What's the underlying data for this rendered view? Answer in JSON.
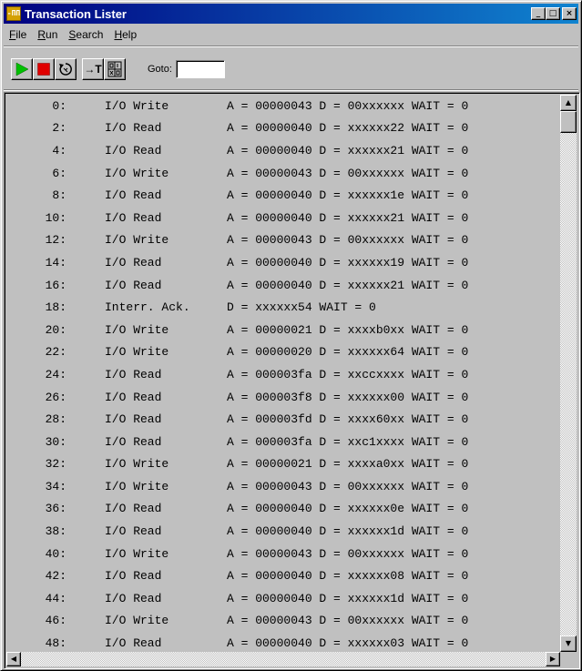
{
  "window": {
    "title": "Transaction Lister",
    "app_icon_text": "-ПП",
    "minimize_glyph": "_",
    "maximize_glyph": "□",
    "close_glyph": "×"
  },
  "menu": {
    "file": "File",
    "run": "Run",
    "search": "Search",
    "help": "Help"
  },
  "toolbar": {
    "buttons": [
      "run-icon",
      "stop-icon",
      "loop-icon",
      "trigger-icon",
      "binary-hex-icon"
    ],
    "trigger_label": "→T",
    "goto_label": "Goto:",
    "goto_value": ""
  },
  "colors": {
    "run": "#00c000",
    "stop": "#e00000",
    "title_start": "#000080",
    "title_end": "#1084d0",
    "face": "#c0c0c0"
  },
  "scrollbar": {
    "up": "▲",
    "down": "▼",
    "left": "◀",
    "right": "▶"
  },
  "rows": [
    {
      "idx": "0:",
      "kind": "I/O Write",
      "detail": "A = 00000043 D = 00xxxxxx WAIT = 0"
    },
    {
      "idx": "2:",
      "kind": "I/O Read",
      "detail": "A = 00000040 D = xxxxxx22 WAIT = 0"
    },
    {
      "idx": "4:",
      "kind": "I/O Read",
      "detail": "A = 00000040 D = xxxxxx21 WAIT = 0"
    },
    {
      "idx": "6:",
      "kind": "I/O Write",
      "detail": "A = 00000043 D = 00xxxxxx WAIT = 0"
    },
    {
      "idx": "8:",
      "kind": "I/O Read",
      "detail": "A = 00000040 D = xxxxxx1e WAIT = 0"
    },
    {
      "idx": "10:",
      "kind": "I/O Read",
      "detail": "A = 00000040 D = xxxxxx21 WAIT = 0"
    },
    {
      "idx": "12:",
      "kind": "I/O Write",
      "detail": "A = 00000043 D = 00xxxxxx WAIT = 0"
    },
    {
      "idx": "14:",
      "kind": "I/O Read",
      "detail": "A = 00000040 D = xxxxxx19 WAIT = 0"
    },
    {
      "idx": "16:",
      "kind": "I/O Read",
      "detail": "A = 00000040 D = xxxxxx21 WAIT = 0"
    },
    {
      "idx": "18:",
      "kind": "Interr. Ack.",
      "detail": "D = xxxxxx54 WAIT = 0"
    },
    {
      "idx": "20:",
      "kind": "I/O Write",
      "detail": "A = 00000021 D = xxxxb0xx WAIT = 0"
    },
    {
      "idx": "22:",
      "kind": "I/O Write",
      "detail": "A = 00000020 D = xxxxxx64 WAIT = 0"
    },
    {
      "idx": "24:",
      "kind": "I/O Read",
      "detail": "A = 000003fa D = xxccxxxx WAIT = 0"
    },
    {
      "idx": "26:",
      "kind": "I/O Read",
      "detail": "A = 000003f8 D = xxxxxx00 WAIT = 0"
    },
    {
      "idx": "28:",
      "kind": "I/O Read",
      "detail": "A = 000003fd D = xxxx60xx WAIT = 0"
    },
    {
      "idx": "30:",
      "kind": "I/O Read",
      "detail": "A = 000003fa D = xxc1xxxx WAIT = 0"
    },
    {
      "idx": "32:",
      "kind": "I/O Write",
      "detail": "A = 00000021 D = xxxxa0xx WAIT = 0"
    },
    {
      "idx": "34:",
      "kind": "I/O Write",
      "detail": "A = 00000043 D = 00xxxxxx WAIT = 0"
    },
    {
      "idx": "36:",
      "kind": "I/O Read",
      "detail": "A = 00000040 D = xxxxxx0e WAIT = 0"
    },
    {
      "idx": "38:",
      "kind": "I/O Read",
      "detail": "A = 00000040 D = xxxxxx1d WAIT = 0"
    },
    {
      "idx": "40:",
      "kind": "I/O Write",
      "detail": "A = 00000043 D = 00xxxxxx WAIT = 0"
    },
    {
      "idx": "42:",
      "kind": "I/O Read",
      "detail": "A = 00000040 D = xxxxxx08 WAIT = 0"
    },
    {
      "idx": "44:",
      "kind": "I/O Read",
      "detail": "A = 00000040 D = xxxxxx1d WAIT = 0"
    },
    {
      "idx": "46:",
      "kind": "I/O Write",
      "detail": "A = 00000043 D = 00xxxxxx WAIT = 0"
    },
    {
      "idx": "48:",
      "kind": "I/O Read",
      "detail": "A = 00000040 D = xxxxxx03 WAIT = 0"
    }
  ]
}
